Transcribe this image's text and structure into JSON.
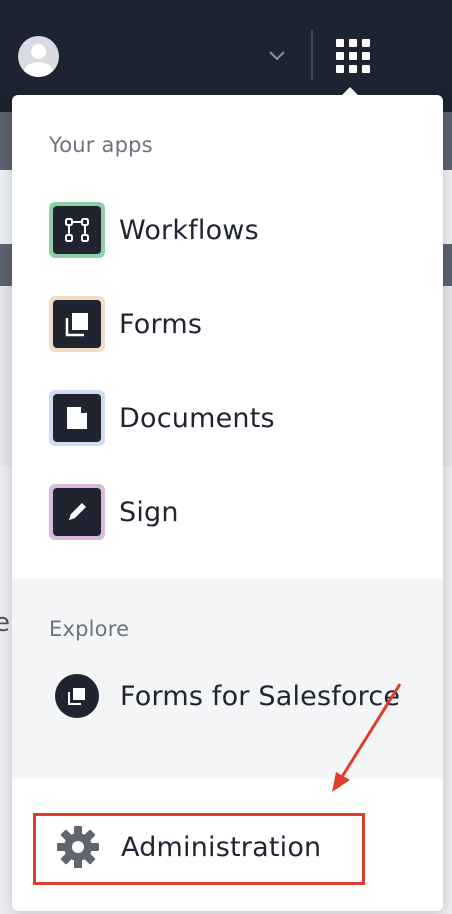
{
  "topbar": {
    "avatar_icon": "user-avatar-icon",
    "dropdown_icon": "chevron-down-icon",
    "apps_launcher_icon": "app-grid-icon",
    "background_color": "#1c2432"
  },
  "app_switcher": {
    "your_apps_heading": "Your apps",
    "apps": [
      {
        "label": "Workflows",
        "icon": "workflows-icon",
        "tile_color": "#8fcfa8"
      },
      {
        "label": "Forms",
        "icon": "forms-icon",
        "tile_color": "#f3dcc6"
      },
      {
        "label": "Documents",
        "icon": "documents-icon",
        "tile_color": "#cddcef"
      },
      {
        "label": "Sign",
        "icon": "sign-pencil-icon",
        "tile_color": "#d7b9d9"
      }
    ],
    "explore_heading": "Explore",
    "explore_items": [
      {
        "label": "Forms for Salesforce",
        "icon": "forms-for-salesforce-icon"
      }
    ],
    "admin": {
      "label": "Administration",
      "icon": "gear-icon"
    }
  },
  "annotation": {
    "highlight_color": "#e03e2d",
    "arrow_color": "#e03e2d"
  }
}
